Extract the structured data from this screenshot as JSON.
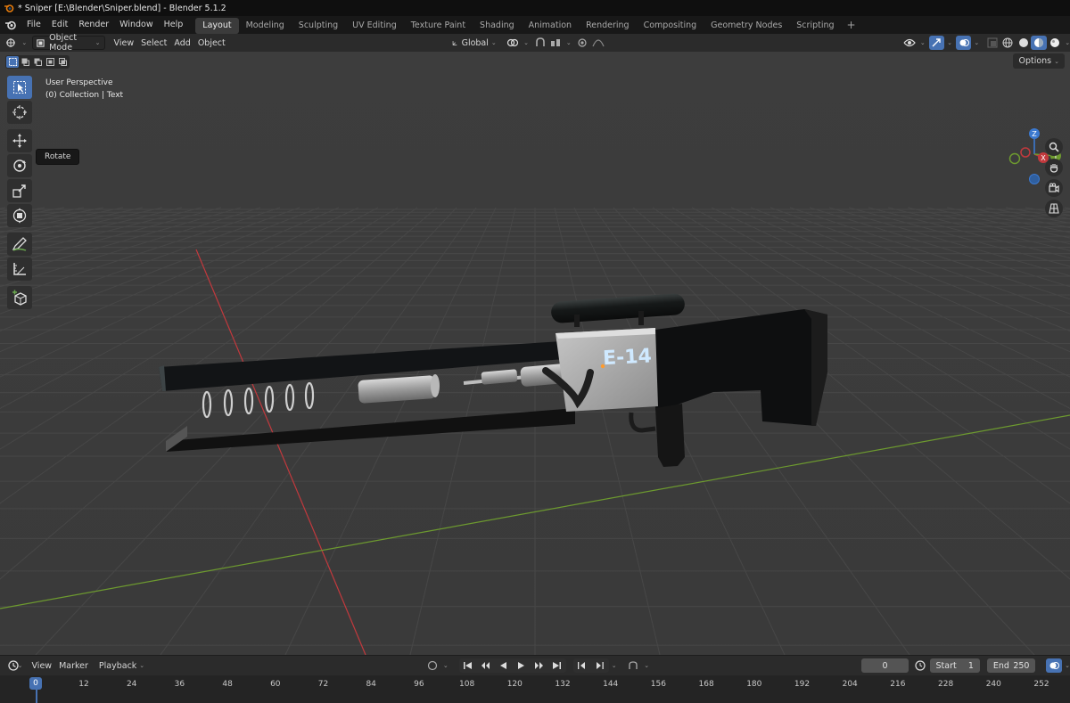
{
  "window": {
    "title": "* Sniper [E:\\Blender\\Sniper.blend] - Blender 5.1.2"
  },
  "menu": [
    "File",
    "Edit",
    "Render",
    "Window",
    "Help"
  ],
  "workspaces": {
    "active": "Layout",
    "tabs": [
      "Layout",
      "Modeling",
      "Sculpting",
      "UV Editing",
      "Texture Paint",
      "Shading",
      "Animation",
      "Rendering",
      "Compositing",
      "Geometry Nodes",
      "Scripting"
    ]
  },
  "header": {
    "mode": "Object Mode",
    "menus": [
      "View",
      "Select",
      "Add",
      "Object"
    ],
    "orientation": "Global"
  },
  "toolsettings": {
    "options_label": "Options"
  },
  "viewport": {
    "perspective": "User Perspective",
    "collection": "(0) Collection | Text",
    "tooltip": "Rotate",
    "model_label": "E-14",
    "gizmo": {
      "x": "X",
      "y": "Y",
      "z": "Z"
    }
  },
  "timeline": {
    "menus": [
      "View",
      "Marker",
      "Playback"
    ],
    "current_frame": "0",
    "start_label": "Start",
    "start": "1",
    "end_label": "End",
    "end": "250",
    "playhead_label": "0",
    "ticks": [
      "12",
      "24",
      "36",
      "48",
      "60",
      "72",
      "84",
      "96",
      "108",
      "120",
      "132",
      "144",
      "156",
      "168",
      "180",
      "192",
      "204",
      "216",
      "228",
      "240",
      "252"
    ]
  },
  "icons": {
    "toolbar": [
      "select-box-icon",
      "cursor-icon",
      "move-icon",
      "rotate-icon",
      "scale-icon",
      "transform-icon",
      "annotate-icon",
      "measure-icon",
      "add-cube-icon"
    ],
    "navigation": [
      "zoom-icon",
      "pan-hand-icon",
      "camera-view-icon",
      "ortho-grid-icon"
    ]
  },
  "colors": {
    "accent": "#4772b3",
    "viewport_bg": "#3a3a3a",
    "x_axis": "#c2393d",
    "y_axis": "#6d9a2f",
    "z_axis": "#3b79d0",
    "model_text": "#cfe9ff"
  }
}
